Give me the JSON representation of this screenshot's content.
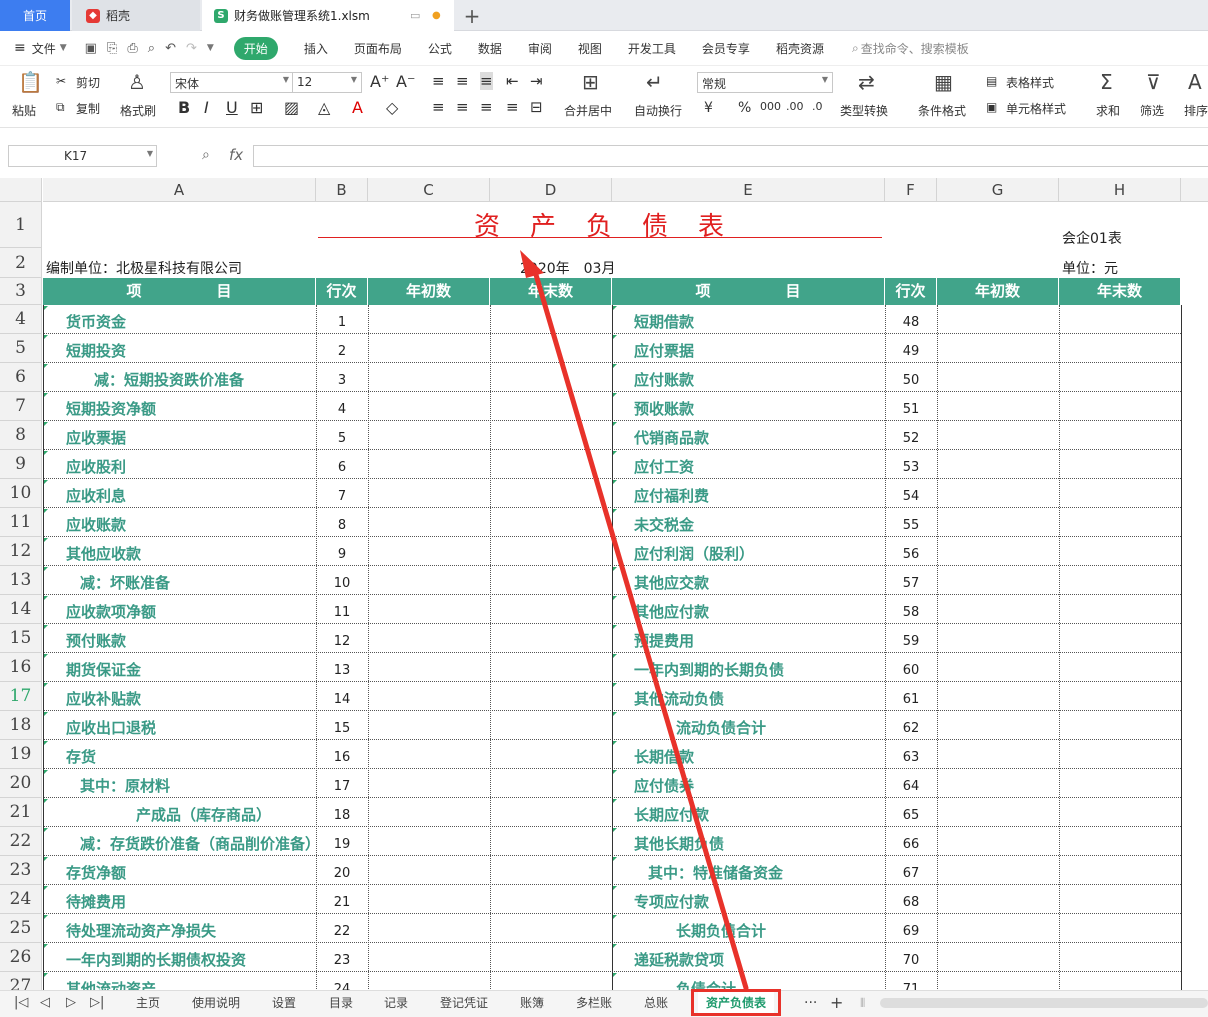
{
  "tabs": {
    "home": "首页",
    "daoke": "稻壳",
    "file": "财务做账管理系统1.xlsm"
  },
  "menu": {
    "file": "文件",
    "items": [
      "开始",
      "插入",
      "页面布局",
      "公式",
      "数据",
      "审阅",
      "视图",
      "开发工具",
      "会员专享",
      "稻壳资源"
    ],
    "search": "查找命令、搜索模板"
  },
  "ribbon": {
    "paste": "粘贴",
    "cut": "剪切",
    "copy": "复制",
    "format_painter": "格式刷",
    "font_name": "宋体",
    "font_size": "12",
    "merge": "合并居中",
    "wrap": "自动换行",
    "number_format": "常规",
    "convert": "类型转换",
    "cond_format": "条件格式",
    "table_style": "表格样式",
    "cell_style": "单元格样式",
    "sum": "求和",
    "filter": "筛选",
    "sort": "排序"
  },
  "formula": {
    "cell_ref": "K17",
    "fx": "fx"
  },
  "columns": [
    "A",
    "B",
    "C",
    "D",
    "E",
    "F",
    "G",
    "H"
  ],
  "sheet": {
    "title": "资　产　负　债　表",
    "form_no": "会企01表",
    "company": "编制单位：北极星科技有限公司",
    "period": "2020年　03月",
    "unit": "单位：元",
    "headers": {
      "item": "项　　　　　目",
      "row_no": "行次",
      "begin": "年初数",
      "end": "年末数"
    },
    "left": [
      {
        "label": "货币资金",
        "no": "1",
        "indent": 0
      },
      {
        "label": "短期投资",
        "no": "2",
        "indent": 0
      },
      {
        "label": "减：短期投资跌价准备",
        "no": "3",
        "indent": 2
      },
      {
        "label": "短期投资净额",
        "no": "4",
        "indent": 0
      },
      {
        "label": "应收票据",
        "no": "5",
        "indent": 0
      },
      {
        "label": "应收股利",
        "no": "6",
        "indent": 0
      },
      {
        "label": "应收利息",
        "no": "7",
        "indent": 0
      },
      {
        "label": "应收账款",
        "no": "8",
        "indent": 0
      },
      {
        "label": "其他应收款",
        "no": "9",
        "indent": 0
      },
      {
        "label": "减：坏账准备",
        "no": "10",
        "indent": 1
      },
      {
        "label": "应收款项净额",
        "no": "11",
        "indent": 0
      },
      {
        "label": "预付账款",
        "no": "12",
        "indent": 0
      },
      {
        "label": "期货保证金",
        "no": "13",
        "indent": 0
      },
      {
        "label": "应收补贴款",
        "no": "14",
        "indent": 0
      },
      {
        "label": "应收出口退税",
        "no": "15",
        "indent": 0
      },
      {
        "label": "存货",
        "no": "16",
        "indent": 0
      },
      {
        "label": "其中：原材料",
        "no": "17",
        "indent": 1
      },
      {
        "label": "产成品（库存商品）",
        "no": "18",
        "indent": 5
      },
      {
        "label": "减：存货跌价准备（商品削价准备）",
        "no": "19",
        "indent": 1
      },
      {
        "label": "存货净额",
        "no": "20",
        "indent": 0
      },
      {
        "label": "待摊费用",
        "no": "21",
        "indent": 0
      },
      {
        "label": "待处理流动资产净损失",
        "no": "22",
        "indent": 0
      },
      {
        "label": "一年内到期的长期债权投资",
        "no": "23",
        "indent": 0
      },
      {
        "label": "其他流动资产",
        "no": "24",
        "indent": 0
      }
    ],
    "right": [
      {
        "label": "短期借款",
        "no": "48",
        "indent": 0
      },
      {
        "label": "应付票据",
        "no": "49",
        "indent": 0
      },
      {
        "label": "应付账款",
        "no": "50",
        "indent": 0
      },
      {
        "label": "预收账款",
        "no": "51",
        "indent": 0
      },
      {
        "label": "代销商品款",
        "no": "52",
        "indent": 0
      },
      {
        "label": "应付工资",
        "no": "53",
        "indent": 0
      },
      {
        "label": "应付福利费",
        "no": "54",
        "indent": 0
      },
      {
        "label": "未交税金",
        "no": "55",
        "indent": 0
      },
      {
        "label": "应付利润（股利）",
        "no": "56",
        "indent": 0
      },
      {
        "label": "其他应交款",
        "no": "57",
        "indent": 0
      },
      {
        "label": "其他应付款",
        "no": "58",
        "indent": 0
      },
      {
        "label": "预提费用",
        "no": "59",
        "indent": 0
      },
      {
        "label": "一年内到期的长期负债",
        "no": "60",
        "indent": 0
      },
      {
        "label": "其他流动负债",
        "no": "61",
        "indent": 0
      },
      {
        "label": "流动负债合计",
        "no": "62",
        "indent": 3
      },
      {
        "label": "长期借款",
        "no": "63",
        "indent": 0
      },
      {
        "label": "应付债券",
        "no": "64",
        "indent": 0
      },
      {
        "label": "长期应付款",
        "no": "65",
        "indent": 0
      },
      {
        "label": "其他长期负债",
        "no": "66",
        "indent": 0
      },
      {
        "label": "其中：特准储备资金",
        "no": "67",
        "indent": 1
      },
      {
        "label": "专项应付款",
        "no": "68",
        "indent": 0
      },
      {
        "label": "长期负债合计",
        "no": "69",
        "indent": 3
      },
      {
        "label": "递延税款贷项",
        "no": "70",
        "indent": 0
      },
      {
        "label": "负债合计",
        "no": "71",
        "indent": 3
      }
    ]
  },
  "sheet_tabs": [
    "主页",
    "使用说明",
    "设置",
    "目录",
    "记录",
    "登记凭证",
    "账簿",
    "多栏账",
    "总账",
    "资产负债表"
  ],
  "active_sheet": "资产负债表",
  "colors": {
    "header_green": "#41a48a",
    "item_text": "#3a9a86",
    "title_red": "#e02020",
    "annotation_red": "#e8322a"
  }
}
